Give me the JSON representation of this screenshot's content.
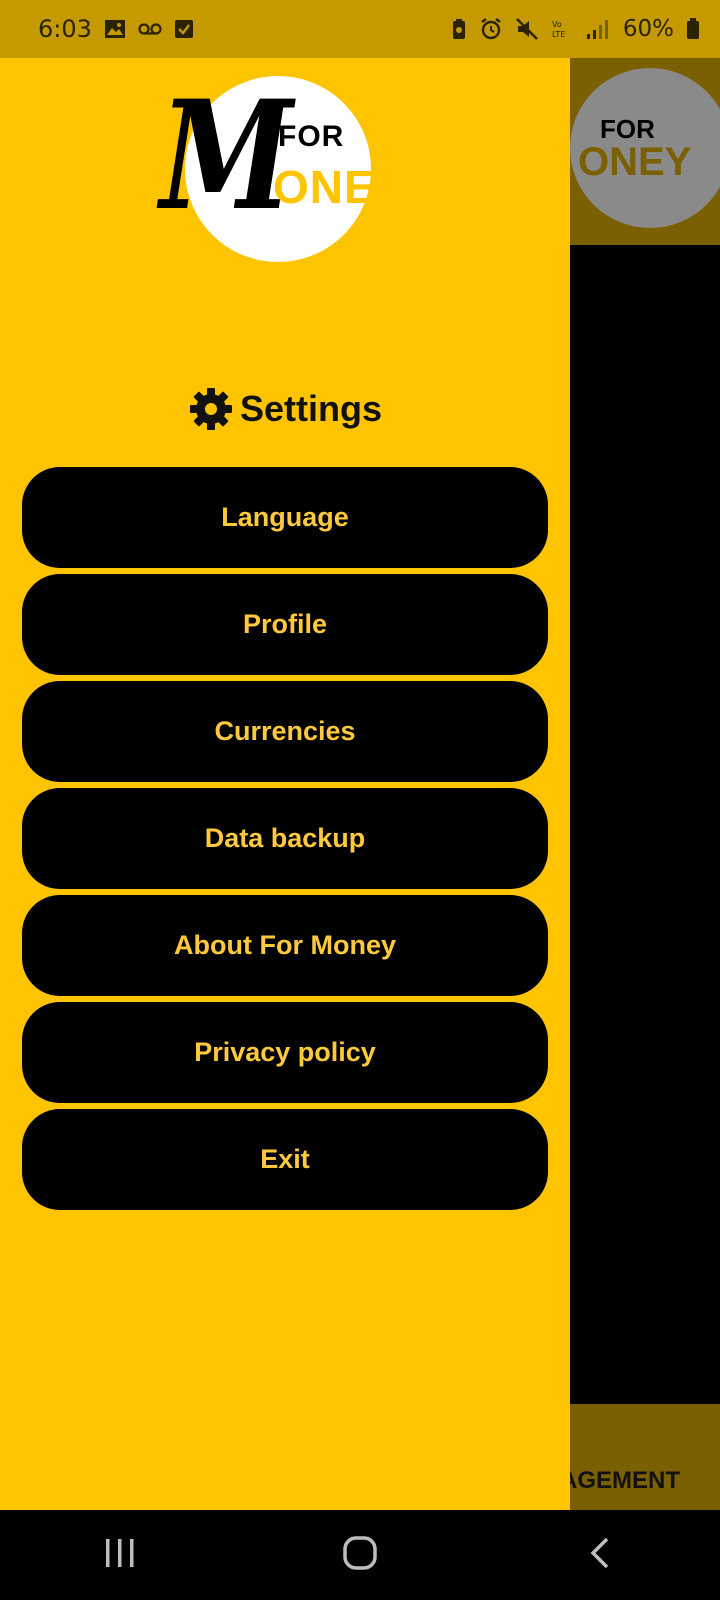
{
  "status_bar": {
    "time": "6:03",
    "battery": "60%",
    "icons": [
      "image-icon",
      "voicemail-icon",
      "checkbox-icon",
      "battery-saver-icon",
      "alarm-icon",
      "mute-icon",
      "volte-icon",
      "signal-icon",
      "battery-icon"
    ]
  },
  "app_logo": {
    "letter": "M",
    "word_top": "FOR",
    "word_bottom": "ONEY"
  },
  "background": {
    "bottom_label": "AGEMENT"
  },
  "drawer": {
    "title": "Settings",
    "menu": [
      {
        "label": "Language"
      },
      {
        "label": "Profile"
      },
      {
        "label": "Currencies"
      },
      {
        "label": "Data backup"
      },
      {
        "label": "About For Money"
      },
      {
        "label": "Privacy policy"
      },
      {
        "label": "Exit"
      }
    ]
  },
  "colors": {
    "accent": "#ffc400",
    "button_bg": "#000000",
    "button_text": "#ffc93c"
  }
}
